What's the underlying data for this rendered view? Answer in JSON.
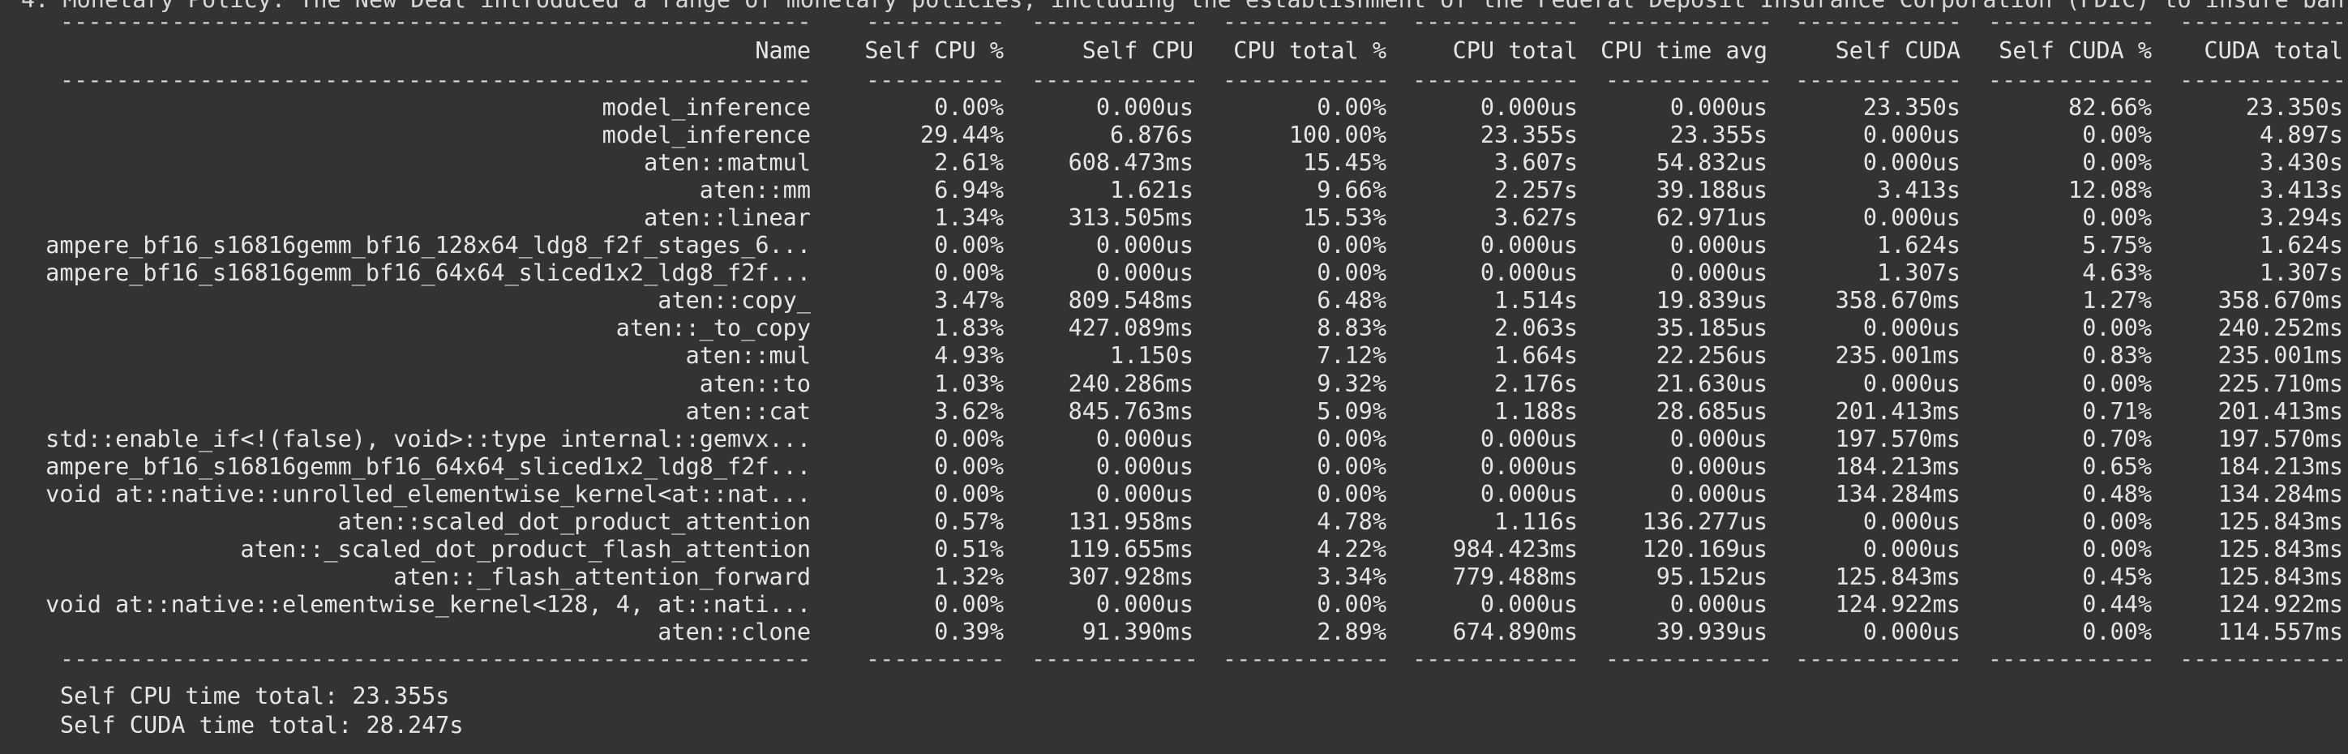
{
  "terminal": {
    "top_line": "4. Monetary Policy: The New Deal introduced a range of monetary policies, including the establishment of the Federal Deposit Insurance Corporation (FDIC) to insure ban",
    "columns": [
      "Name",
      "Self CPU %",
      "Self CPU",
      "CPU total %",
      "CPU total",
      "CPU time avg",
      "Self CUDA",
      "Self CUDA %",
      "CUDA total"
    ],
    "rows": [
      {
        "name": "model_inference",
        "self_cpu_pct": "0.00%",
        "self_cpu": "0.000us",
        "cpu_total_pct": "0.00%",
        "cpu_total": "0.000us",
        "cpu_time_avg": "0.000us",
        "self_cuda": "23.350s",
        "self_cuda_pct": "82.66%",
        "cuda_total": "23.350s"
      },
      {
        "name": "model_inference",
        "self_cpu_pct": "29.44%",
        "self_cpu": "6.876s",
        "cpu_total_pct": "100.00%",
        "cpu_total": "23.355s",
        "cpu_time_avg": "23.355s",
        "self_cuda": "0.000us",
        "self_cuda_pct": "0.00%",
        "cuda_total": "4.897s"
      },
      {
        "name": "aten::matmul",
        "self_cpu_pct": "2.61%",
        "self_cpu": "608.473ms",
        "cpu_total_pct": "15.45%",
        "cpu_total": "3.607s",
        "cpu_time_avg": "54.832us",
        "self_cuda": "0.000us",
        "self_cuda_pct": "0.00%",
        "cuda_total": "3.430s"
      },
      {
        "name": "aten::mm",
        "self_cpu_pct": "6.94%",
        "self_cpu": "1.621s",
        "cpu_total_pct": "9.66%",
        "cpu_total": "2.257s",
        "cpu_time_avg": "39.188us",
        "self_cuda": "3.413s",
        "self_cuda_pct": "12.08%",
        "cuda_total": "3.413s"
      },
      {
        "name": "aten::linear",
        "self_cpu_pct": "1.34%",
        "self_cpu": "313.505ms",
        "cpu_total_pct": "15.53%",
        "cpu_total": "3.627s",
        "cpu_time_avg": "62.971us",
        "self_cuda": "0.000us",
        "self_cuda_pct": "0.00%",
        "cuda_total": "3.294s"
      },
      {
        "name": "ampere_bf16_s16816gemm_bf16_128x64_ldg8_f2f_stages_6...",
        "self_cpu_pct": "0.00%",
        "self_cpu": "0.000us",
        "cpu_total_pct": "0.00%",
        "cpu_total": "0.000us",
        "cpu_time_avg": "0.000us",
        "self_cuda": "1.624s",
        "self_cuda_pct": "5.75%",
        "cuda_total": "1.624s"
      },
      {
        "name": "ampere_bf16_s16816gemm_bf16_64x64_sliced1x2_ldg8_f2f...",
        "self_cpu_pct": "0.00%",
        "self_cpu": "0.000us",
        "cpu_total_pct": "0.00%",
        "cpu_total": "0.000us",
        "cpu_time_avg": "0.000us",
        "self_cuda": "1.307s",
        "self_cuda_pct": "4.63%",
        "cuda_total": "1.307s"
      },
      {
        "name": "aten::copy_",
        "self_cpu_pct": "3.47%",
        "self_cpu": "809.548ms",
        "cpu_total_pct": "6.48%",
        "cpu_total": "1.514s",
        "cpu_time_avg": "19.839us",
        "self_cuda": "358.670ms",
        "self_cuda_pct": "1.27%",
        "cuda_total": "358.670ms"
      },
      {
        "name": "aten::_to_copy",
        "self_cpu_pct": "1.83%",
        "self_cpu": "427.089ms",
        "cpu_total_pct": "8.83%",
        "cpu_total": "2.063s",
        "cpu_time_avg": "35.185us",
        "self_cuda": "0.000us",
        "self_cuda_pct": "0.00%",
        "cuda_total": "240.252ms"
      },
      {
        "name": "aten::mul",
        "self_cpu_pct": "4.93%",
        "self_cpu": "1.150s",
        "cpu_total_pct": "7.12%",
        "cpu_total": "1.664s",
        "cpu_time_avg": "22.256us",
        "self_cuda": "235.001ms",
        "self_cuda_pct": "0.83%",
        "cuda_total": "235.001ms"
      },
      {
        "name": "aten::to",
        "self_cpu_pct": "1.03%",
        "self_cpu": "240.286ms",
        "cpu_total_pct": "9.32%",
        "cpu_total": "2.176s",
        "cpu_time_avg": "21.630us",
        "self_cuda": "0.000us",
        "self_cuda_pct": "0.00%",
        "cuda_total": "225.710ms"
      },
      {
        "name": "aten::cat",
        "self_cpu_pct": "3.62%",
        "self_cpu": "845.763ms",
        "cpu_total_pct": "5.09%",
        "cpu_total": "1.188s",
        "cpu_time_avg": "28.685us",
        "self_cuda": "201.413ms",
        "self_cuda_pct": "0.71%",
        "cuda_total": "201.413ms"
      },
      {
        "name": "std::enable_if<!(false), void>::type internal::gemvx...",
        "self_cpu_pct": "0.00%",
        "self_cpu": "0.000us",
        "cpu_total_pct": "0.00%",
        "cpu_total": "0.000us",
        "cpu_time_avg": "0.000us",
        "self_cuda": "197.570ms",
        "self_cuda_pct": "0.70%",
        "cuda_total": "197.570ms"
      },
      {
        "name": "ampere_bf16_s16816gemm_bf16_64x64_sliced1x2_ldg8_f2f...",
        "self_cpu_pct": "0.00%",
        "self_cpu": "0.000us",
        "cpu_total_pct": "0.00%",
        "cpu_total": "0.000us",
        "cpu_time_avg": "0.000us",
        "self_cuda": "184.213ms",
        "self_cuda_pct": "0.65%",
        "cuda_total": "184.213ms"
      },
      {
        "name": "void at::native::unrolled_elementwise_kernel<at::nat...",
        "self_cpu_pct": "0.00%",
        "self_cpu": "0.000us",
        "cpu_total_pct": "0.00%",
        "cpu_total": "0.000us",
        "cpu_time_avg": "0.000us",
        "self_cuda": "134.284ms",
        "self_cuda_pct": "0.48%",
        "cuda_total": "134.284ms"
      },
      {
        "name": "aten::scaled_dot_product_attention",
        "self_cpu_pct": "0.57%",
        "self_cpu": "131.958ms",
        "cpu_total_pct": "4.78%",
        "cpu_total": "1.116s",
        "cpu_time_avg": "136.277us",
        "self_cuda": "0.000us",
        "self_cuda_pct": "0.00%",
        "cuda_total": "125.843ms"
      },
      {
        "name": "aten::_scaled_dot_product_flash_attention",
        "self_cpu_pct": "0.51%",
        "self_cpu": "119.655ms",
        "cpu_total_pct": "4.22%",
        "cpu_total": "984.423ms",
        "cpu_time_avg": "120.169us",
        "self_cuda": "0.000us",
        "self_cuda_pct": "0.00%",
        "cuda_total": "125.843ms"
      },
      {
        "name": "aten::_flash_attention_forward",
        "self_cpu_pct": "1.32%",
        "self_cpu": "307.928ms",
        "cpu_total_pct": "3.34%",
        "cpu_total": "779.488ms",
        "cpu_time_avg": "95.152us",
        "self_cuda": "125.843ms",
        "self_cuda_pct": "0.45%",
        "cuda_total": "125.843ms"
      },
      {
        "name": "void at::native::elementwise_kernel<128, 4, at::nati...",
        "self_cpu_pct": "0.00%",
        "self_cpu": "0.000us",
        "cpu_total_pct": "0.00%",
        "cpu_total": "0.000us",
        "cpu_time_avg": "0.000us",
        "self_cuda": "124.922ms",
        "self_cuda_pct": "0.44%",
        "cuda_total": "124.922ms"
      },
      {
        "name": "aten::clone",
        "self_cpu_pct": "0.39%",
        "self_cpu": "91.390ms",
        "cpu_total_pct": "2.89%",
        "cpu_total": "674.890ms",
        "cpu_time_avg": "39.939us",
        "self_cuda": "0.000us",
        "self_cuda_pct": "0.00%",
        "cuda_total": "114.557ms"
      }
    ],
    "footer": {
      "self_cpu_total": "Self CPU time total: 23.355s",
      "self_cuda_total": "Self CUDA time total: 28.247s"
    }
  }
}
